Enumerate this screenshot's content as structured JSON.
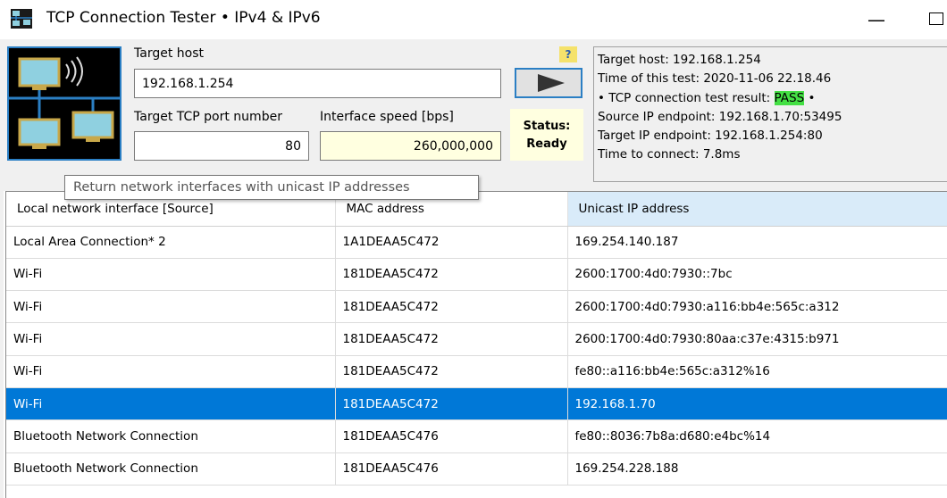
{
  "window": {
    "title": "TCP Connection Tester • IPv4 & IPv6",
    "minimize_glyph": "—"
  },
  "form": {
    "target_host_label": "Target host",
    "target_host_value": "192.168.1.254",
    "port_label": "Target TCP port number",
    "port_value": "80",
    "speed_label": "Interface speed [bps]",
    "speed_value": "260,000,000",
    "help_label": "?",
    "start_icon": "play-icon",
    "status_label": "Status:",
    "status_value": "Ready"
  },
  "result": {
    "target_host": "Target host: 192.168.1.254",
    "time_of_test": "Time of this test: 2020-11-06 22.18.46",
    "result_prefix": "• TCP connection test result: ",
    "result_value": "PASS",
    "result_suffix": " •",
    "source_endpoint": "Source IP endpoint: 192.168.1.70:53495",
    "target_endpoint": "Target IP endpoint: 192.168.1.254:80",
    "time_to_connect": "Time to connect: 7.8ms"
  },
  "tooltip": "Return network interfaces with unicast IP addresses",
  "table": {
    "columns": [
      "Local network interface [Source]",
      "MAC address",
      "Unicast IP address"
    ],
    "rows": [
      [
        "Local Area Connection* 2",
        "1A1DEAA5C472",
        "169.254.140.187"
      ],
      [
        "Wi-Fi",
        "181DEAA5C472",
        "2600:1700:4d0:7930::7bc"
      ],
      [
        "Wi-Fi",
        "181DEAA5C472",
        "2600:1700:4d0:7930:a116:bb4e:565c:a312"
      ],
      [
        "Wi-Fi",
        "181DEAA5C472",
        "2600:1700:4d0:7930:80aa:c37e:4315:b971"
      ],
      [
        "Wi-Fi",
        "181DEAA5C472",
        "fe80::a116:bb4e:565c:a312%16"
      ],
      [
        "Wi-Fi",
        "181DEAA5C472",
        "192.168.1.70"
      ],
      [
        "Bluetooth Network Connection",
        "181DEAA5C476",
        "fe80::8036:7b8a:d680:e4bc%14"
      ],
      [
        "Bluetooth Network Connection",
        "181DEAA5C476",
        "169.254.228.188"
      ]
    ],
    "selected_row": 5
  },
  "colors": {
    "accent": "#2b7fc4",
    "selection": "#0078d7",
    "pass": "#44e044",
    "readonly_bg": "#ffffe0"
  }
}
